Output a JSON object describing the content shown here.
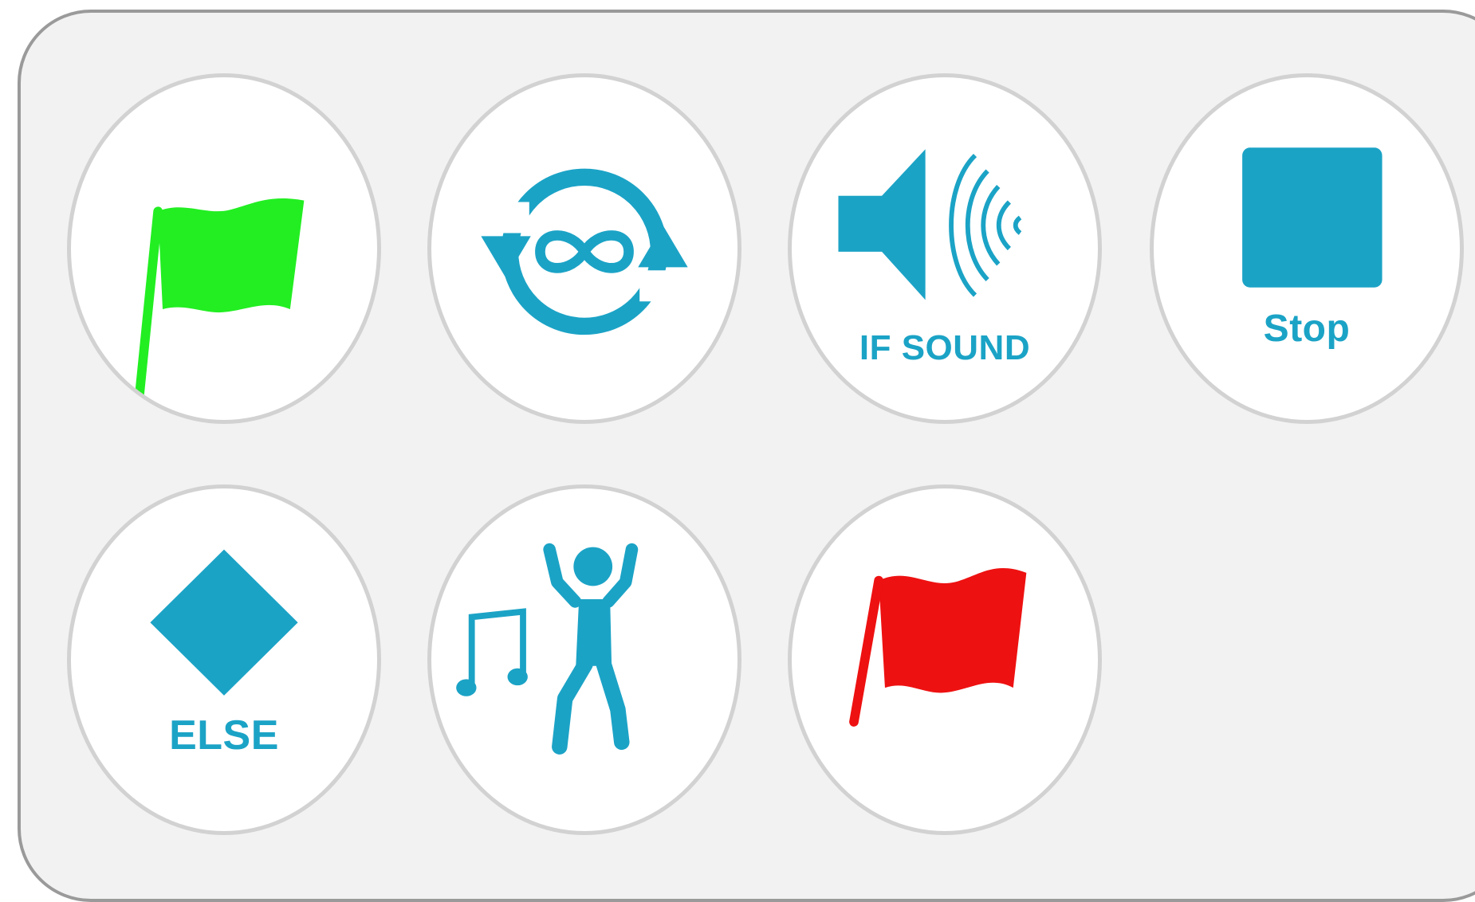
{
  "blocks": [
    {
      "id": "green-flag",
      "icon": "green-flag-icon",
      "label": ""
    },
    {
      "id": "repeat-forever",
      "icon": "infinity-loop-icon",
      "label": ""
    },
    {
      "id": "if-sound",
      "icon": "speaker-sound-icon",
      "label": "IF SOUND"
    },
    {
      "id": "stop",
      "icon": "stop-square-icon",
      "label": "Stop"
    },
    {
      "id": "else",
      "icon": "diamond-icon",
      "label": "ELSE"
    },
    {
      "id": "dance",
      "icon": "dancing-person-icon",
      "label": ""
    },
    {
      "id": "red-flag",
      "icon": "red-flag-icon",
      "label": ""
    }
  ],
  "colors": {
    "accent": "#1ba3c6",
    "green_flag": "#22ee22",
    "red_flag": "#ee1111",
    "panel_bg": "#f2f2f2",
    "panel_border": "#9a9a9a",
    "tile_border": "#d2d2d2"
  }
}
